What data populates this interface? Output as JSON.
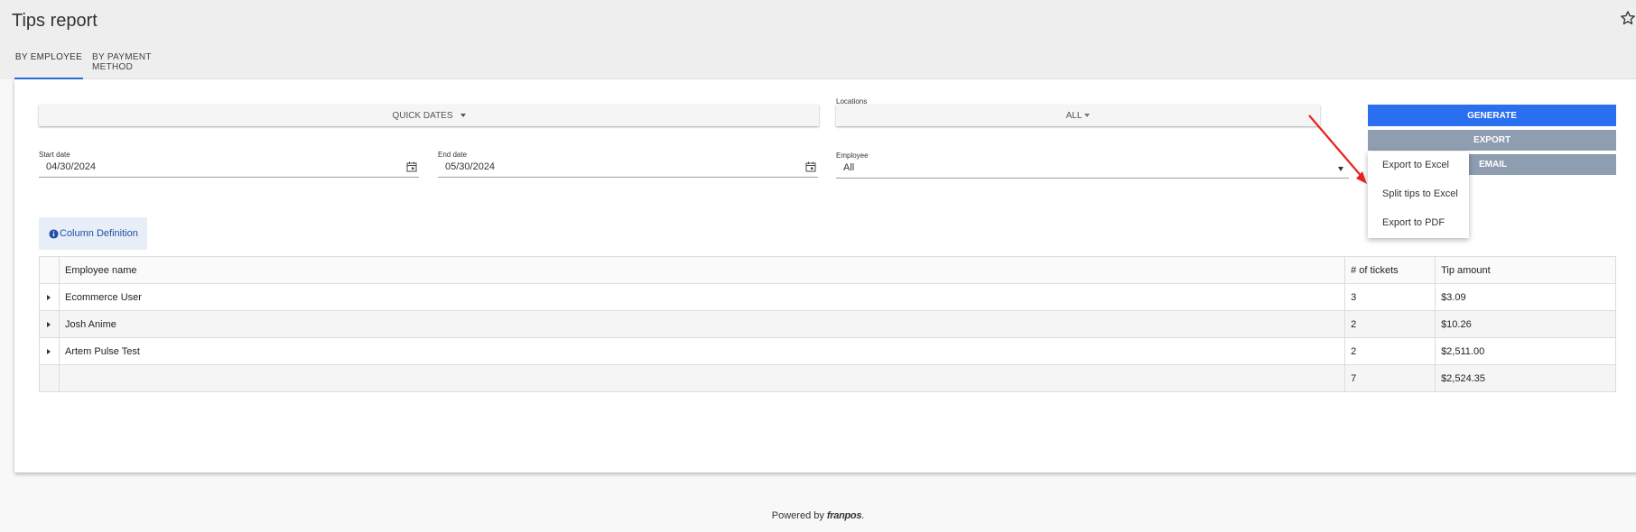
{
  "page": {
    "title": "Tips report"
  },
  "tabs": [
    {
      "label": "BY EMPLOYEE",
      "active": true
    },
    {
      "label": "BY PAYMENT METHOD",
      "active": false
    }
  ],
  "filters": {
    "quick_dates_label": "QUICK DATES",
    "locations_label": "Locations",
    "locations_value": "ALL",
    "start_date_label": "Start date",
    "start_date_value": "04/30/2024",
    "end_date_label": "End date",
    "end_date_value": "05/30/2024",
    "employee_label": "Employee",
    "employee_value": "All"
  },
  "actions": {
    "generate_label": "GENERATE",
    "export_label": "EXPORT",
    "email_label": "EMAIL",
    "generate_color": "#2a6ff0",
    "secondary_color": "#8e9db0"
  },
  "export_menu": {
    "items": [
      {
        "label": "Export to Excel"
      },
      {
        "label": "Split tips to Excel"
      },
      {
        "label": "Export to PDF"
      }
    ]
  },
  "column_definition": {
    "label": "Column Definition"
  },
  "table": {
    "headers": [
      "Employee name",
      "# of tickets",
      "Tip amount"
    ],
    "rows": [
      {
        "name": "Ecommerce User",
        "tickets": "3",
        "tip": "$3.09"
      },
      {
        "name": "Josh Anime",
        "tickets": "2",
        "tip": "$10.26"
      },
      {
        "name": "Artem Pulse Test",
        "tickets": "2",
        "tip": "$2,511.00"
      }
    ],
    "total": {
      "tickets": "7",
      "tip": "$2,524.35"
    }
  },
  "footer": {
    "powered_by": "Powered by",
    "brand": "franpos",
    "suffix": "."
  },
  "icons": {
    "star": "star-outline-icon",
    "calendar": "calendar-icon",
    "info": "info-icon",
    "expand": "expand-arrow-icon",
    "annotation": "red-arrow-annotation"
  },
  "colors": {
    "annotation": "#e8231f",
    "tab_indicator": "#2c6fe0"
  }
}
